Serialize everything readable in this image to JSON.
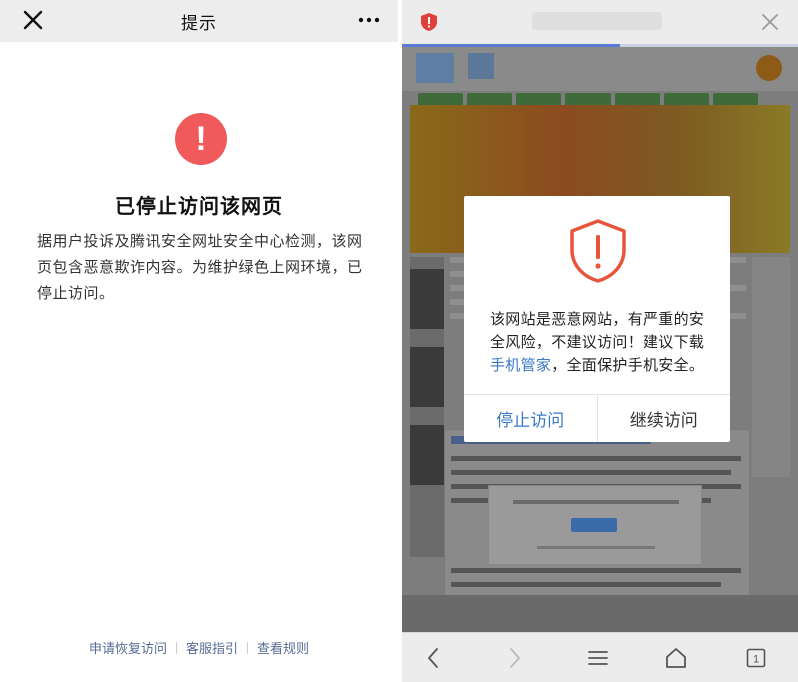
{
  "left_panel": {
    "title": "提示",
    "icons": {
      "close": "close-icon",
      "more": "more-icon",
      "warning": "warning-icon"
    },
    "heading": "已停止访问该网页",
    "body": "据用户投诉及腾讯安全网址安全中心检测，该网页包含恶意欺诈内容。为维护绿色上网环境，已停止访问。",
    "footer_links": [
      "申请恢复访问",
      "客服指引",
      "查看规则"
    ],
    "colors": {
      "warning": "#f05a5a",
      "link": "#576b95"
    }
  },
  "right_panel": {
    "icons": {
      "site_security": "shield-icon",
      "close": "close-icon"
    },
    "page_load_progress": 0.55,
    "modal": {
      "icon": "shield-warning-icon",
      "message_part1": "该网站是恶意网站，有严重的安全风险，不建议访问！建议下载",
      "message_link": "手机管家",
      "message_part2": "，全面保护手机安全。",
      "stop_button": "停止访问",
      "continue_button": "继续访问",
      "colors": {
        "icon": "#e8553a",
        "link": "#3b78c6"
      }
    },
    "toolbar": {
      "icons": [
        "back-icon",
        "forward-icon",
        "menu-icon",
        "home-icon",
        "tabs-icon"
      ],
      "tab_count": "1"
    }
  }
}
